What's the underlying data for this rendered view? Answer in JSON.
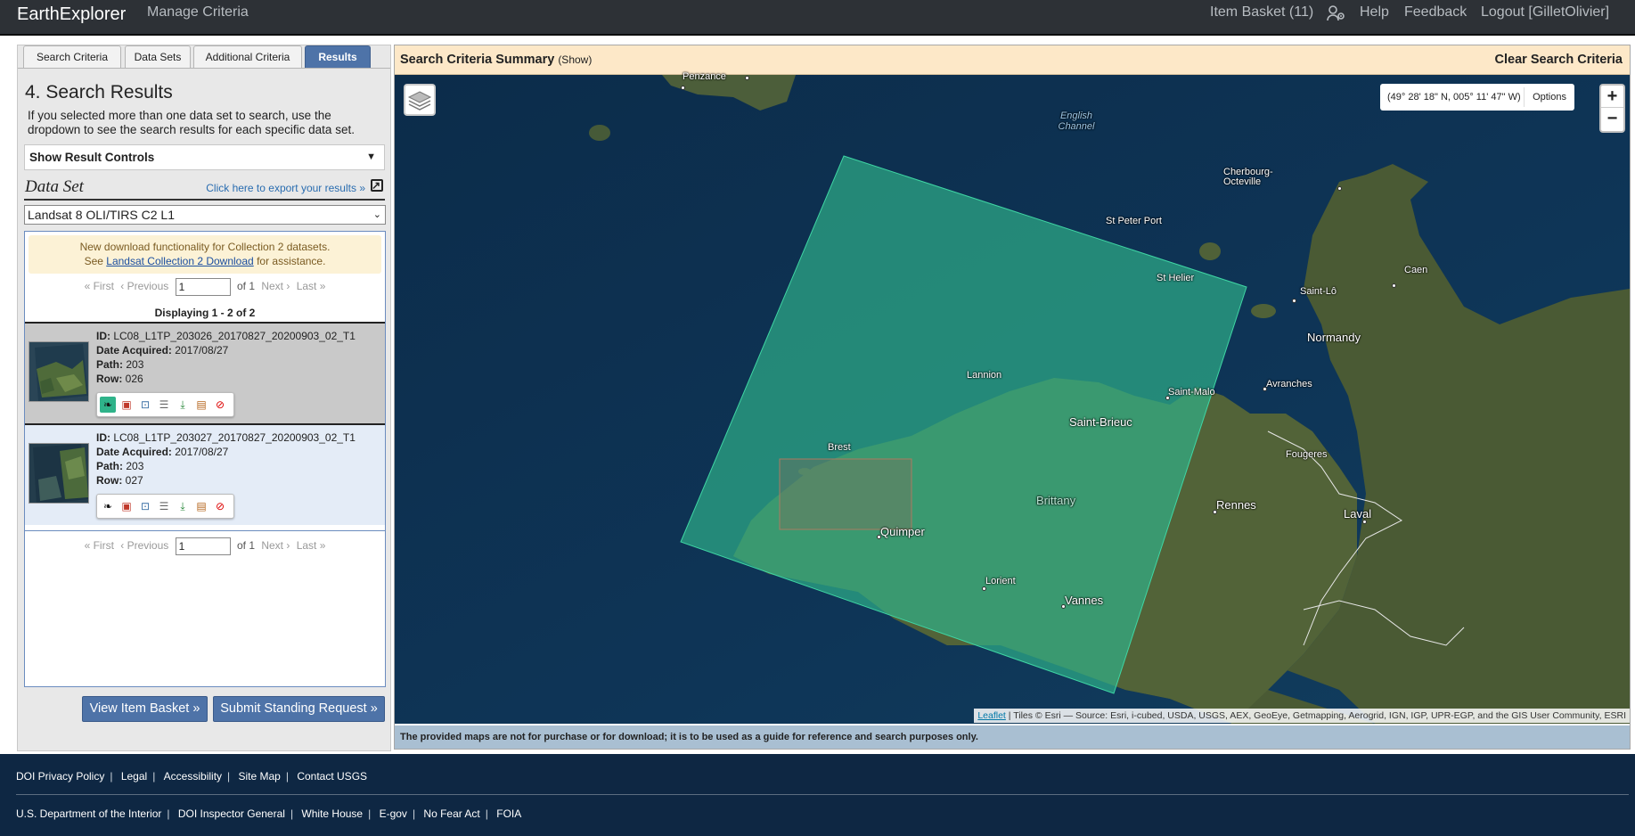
{
  "topnav": {
    "brand": "EarthExplorer",
    "manage": "Manage Criteria",
    "item_basket": "Item Basket (11)",
    "help": "Help",
    "feedback": "Feedback",
    "logout": "Logout [GilletOlivier]"
  },
  "tabs": [
    "Search Criteria",
    "Data Sets",
    "Additional Criteria",
    "Results"
  ],
  "results": {
    "heading": "4. Search Results",
    "intro": "If you selected more than one data set to search, use the dropdown to see the search results for each specific data set.",
    "controls_label": "Show Result Controls",
    "dataset_label": "Data Set",
    "export_link": "Click here to export your results »",
    "dataset_selected": "Landsat 8 OLI/TIRS C2 L1",
    "notice_line1": "New download functionality for Collection 2 datasets.",
    "notice_see": "See",
    "notice_link": "Landsat Collection 2 Download",
    "notice_after": "for assistance.",
    "pager": {
      "first": "« First",
      "prev": "‹ Previous",
      "page": "1",
      "of": "of 1",
      "next": "Next ›",
      "last": "Last »"
    },
    "displaying": "Displaying 1 - 2 of 2",
    "labels": {
      "id": "ID:",
      "date": "Date Acquired:",
      "path": "Path:",
      "row": "Row:"
    },
    "items": [
      {
        "id": "LC08_L1TP_203026_20170827_20200903_02_T1",
        "date": "2017/08/27",
        "path": "203",
        "row": "026",
        "footprint_active": true
      },
      {
        "id": "LC08_L1TP_203027_20170827_20200903_02_T1",
        "date": "2017/08/27",
        "path": "203",
        "row": "027",
        "footprint_active": false
      }
    ],
    "view_basket": "View Item Basket »",
    "standing_request": "Submit Standing Request »"
  },
  "map": {
    "summary_title": "Search Criteria Summary",
    "summary_show": "(Show)",
    "clear": "Clear Search Criteria",
    "coords": "(49° 28' 18\" N, 005° 11' 47\" W)",
    "options": "Options",
    "zoom_in": "+",
    "zoom_out": "−",
    "attribution_link": "Leaflet",
    "attribution_text": " | Tiles © Esri — Source: Esri, i-cubed, USDA, USGS, AEX, GeoEye, Getmapping, Aerogrid, IGN, IGP, UPR-EGP, and the GIS User Community, ESRI",
    "disclaimer": "The provided maps are not for purchase or for download; it is to be used as a guide for reference and search purposes only.",
    "places": [
      "Penzance",
      "English Channel",
      "Cherbourg-Octeville",
      "St Peter Port",
      "St Helier",
      "Saint-Lô",
      "Caen",
      "Normandy",
      "Lannion",
      "Avranches",
      "Saint-Malo",
      "Saint-Brieuc",
      "Brest",
      "Fougeres",
      "Brittany",
      "Rennes",
      "Laval",
      "Quimper",
      "Lorient",
      "Vannes"
    ]
  },
  "footer": {
    "row1": [
      "DOI Privacy Policy",
      "Legal",
      "Accessibility",
      "Site Map",
      "Contact USGS"
    ],
    "row2": [
      "U.S. Department of the Interior",
      "DOI Inspector General",
      "White House",
      "E-gov",
      "No Fear Act",
      "FOIA"
    ]
  },
  "colors": {
    "nav_bg": "#2d3136",
    "accent": "#4e73a8",
    "footer_bg": "#0e2743",
    "footprint": "#2fb38a",
    "summary_bg": "#fde8c8"
  }
}
